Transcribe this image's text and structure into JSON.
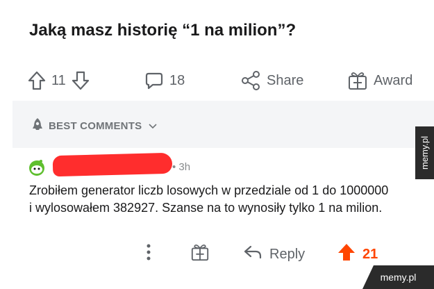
{
  "post": {
    "title": "Jaką masz historię “1 na milion”?"
  },
  "actions": {
    "upvotes": "11",
    "comments": "18",
    "share_label": "Share",
    "award_label": "Award"
  },
  "best_comments": {
    "label": "BEST COMMENTS"
  },
  "comment": {
    "time": "• 3h",
    "body": "Zrobiłem generator liczb losowych w przedziale od 1 do 1000000 i wylosowałem 382927. Szanse na to wynosiły tylko 1 na milion.",
    "reply_label": "Reply",
    "votes": "21"
  },
  "watermarks": {
    "side": "memy.pl",
    "corner": "memy.pl"
  },
  "colors": {
    "upvote_active": "#ff4500",
    "redaction": "#ff2d2d",
    "icon_gray": "#5f6368"
  }
}
